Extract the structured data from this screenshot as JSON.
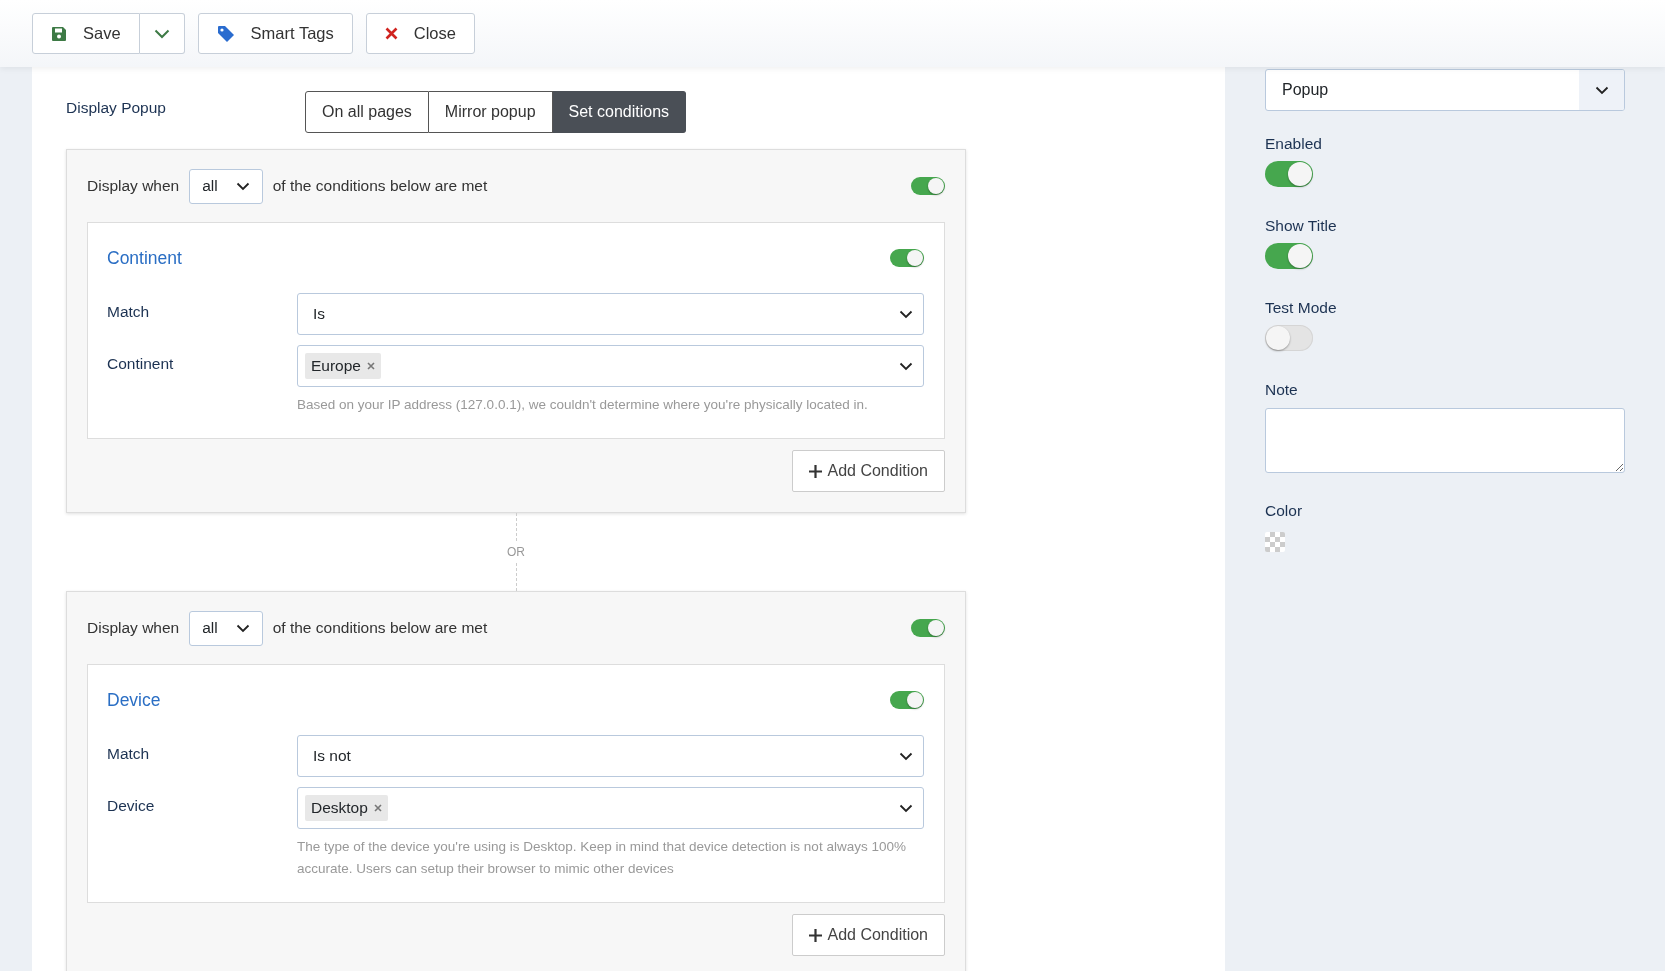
{
  "toolbar": [
    {
      "kind": "save",
      "label": "Save"
    },
    {
      "kind": "caret"
    },
    {
      "kind": "tag",
      "label": "Smart Tags"
    },
    {
      "kind": "close",
      "label": "Close"
    }
  ],
  "display": {
    "label": "Display Popup",
    "options": [
      {
        "label": "On all pages",
        "selected": false
      },
      {
        "label": "Mirror popup",
        "selected": false
      },
      {
        "label": "Set conditions",
        "selected": true
      }
    ]
  },
  "separator": "OR",
  "groups": [
    {
      "prefix": "Display when",
      "operator": "all",
      "suffix": "of the conditions below are met",
      "enabled": true,
      "add_button": "Add Condition",
      "conditions": [
        {
          "title": "Continent",
          "enabled": true,
          "fields": [
            {
              "label": "Match",
              "kind": "select",
              "value": "Is"
            },
            {
              "label": "Continent",
              "kind": "tags",
              "tags": [
                "Europe"
              ]
            }
          ],
          "help": "Based on your IP address (127.0.0.1), we couldn't determine where you're physically located in."
        }
      ]
    },
    {
      "prefix": "Display when",
      "operator": "all",
      "suffix": "of the conditions below are met",
      "enabled": true,
      "add_button": "Add Condition",
      "conditions": [
        {
          "title": "Device",
          "enabled": true,
          "fields": [
            {
              "label": "Match",
              "kind": "select",
              "value": "Is not"
            },
            {
              "label": "Device",
              "kind": "tags",
              "tags": [
                "Desktop"
              ]
            }
          ],
          "help": "The type of the device you're using is Desktop. Keep in mind that device detection is not always 100% accurate. Users can setup their browser to mimic other devices"
        }
      ]
    }
  ],
  "sidebar": {
    "type_select": "Popup",
    "toggles": [
      {
        "label": "Enabled",
        "on": true
      },
      {
        "label": "Show Title",
        "on": true
      },
      {
        "label": "Test Mode",
        "on": false
      }
    ],
    "note": {
      "label": "Note"
    },
    "color": {
      "label": "Color"
    }
  }
}
